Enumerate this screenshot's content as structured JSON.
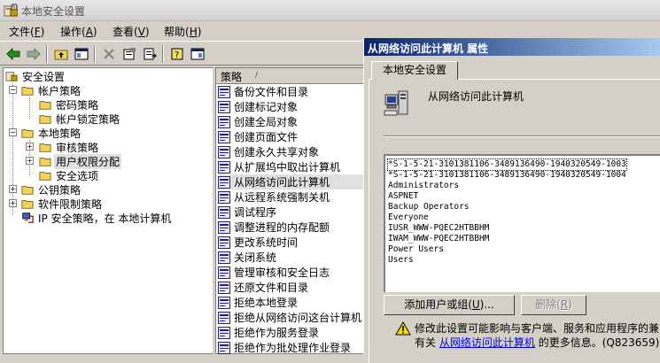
{
  "window": {
    "title": "本地安全设置",
    "icon": "security-settings-icon"
  },
  "menu": [
    {
      "label": "文件(",
      "key": "F",
      "tail": ")"
    },
    {
      "label": "操作(",
      "key": "A",
      "tail": ")"
    },
    {
      "label": "查看(",
      "key": "V",
      "tail": ")"
    },
    {
      "label": "帮助(",
      "key": "H",
      "tail": ")"
    }
  ],
  "toolbar": {
    "icons": [
      "back-icon",
      "forward-icon",
      "up-folder-icon",
      "show-hide-tree-icon",
      "delete-icon",
      "properties-icon",
      "export-list-icon",
      "help-icon",
      "show-hide-action-pane-icon"
    ]
  },
  "tree": {
    "root": "安全设置",
    "items": [
      {
        "label": "帐户策略",
        "expanded": true
      },
      {
        "label": "密码策略"
      },
      {
        "label": "帐户锁定策略"
      },
      {
        "label": "本地策略",
        "expanded": true
      },
      {
        "label": "审核策略",
        "expanded": false
      },
      {
        "label": "用户权限分配",
        "selected": true
      },
      {
        "label": "安全选项"
      },
      {
        "label": "公钥策略",
        "expanded": false
      },
      {
        "label": "软件限制策略",
        "expanded": false
      },
      {
        "label": "IP 安全策略，在 本地计算机"
      }
    ]
  },
  "list": {
    "header": "策略",
    "sort_indicator": "∕",
    "items": [
      "备份文件和目录",
      "创建标记对象",
      "创建全局对象",
      "创建页面文件",
      "创建永久共享对象",
      "从扩展坞中取出计算机",
      "从网络访问此计算机",
      "从远程系统强制关机",
      "调试程序",
      "调整进程的内存配额",
      "更改系统时间",
      "关闭系统",
      "管理审核和安全日志",
      "还原文件和目录",
      "拒绝本地登录",
      "拒绝从网络访问这台计算机",
      "拒绝作为服务登录",
      "拒绝作为批处理作业登录"
    ],
    "selected_index": 6
  },
  "dialog": {
    "title": "从网络访问此计算机 属性",
    "tab": "本地安全设置",
    "policy_name": "从网络访问此计算机",
    "policy_icon": "computer-policy-icon",
    "users": [
      "*S-1-5-21-3101381106-3489136490-1940320549-1003",
      "*S-1-5-21-3101381106-3489136490-1940320549-1004",
      "Administrators",
      "ASPNET",
      "Backup Operators",
      "Everyone",
      "IUSR_WWW-PQEC2HTBBHM",
      "IWAM_WWW-PQEC2HTBBHM",
      "Power Users",
      "Users"
    ],
    "add_button": {
      "label": "添加用户或组(",
      "key": "U",
      "tail": ")..."
    },
    "remove_button": {
      "label": "删除(",
      "key": "R",
      "tail": ")"
    },
    "warning": {
      "icon": "warning-icon",
      "line1": "修改此设置可能影响与客户端、服务和应用程序的兼",
      "line2_prefix": "有关",
      "link": "从网络访问此计算机",
      "line2_suffix": "的更多信息。(Q823659)"
    }
  }
}
